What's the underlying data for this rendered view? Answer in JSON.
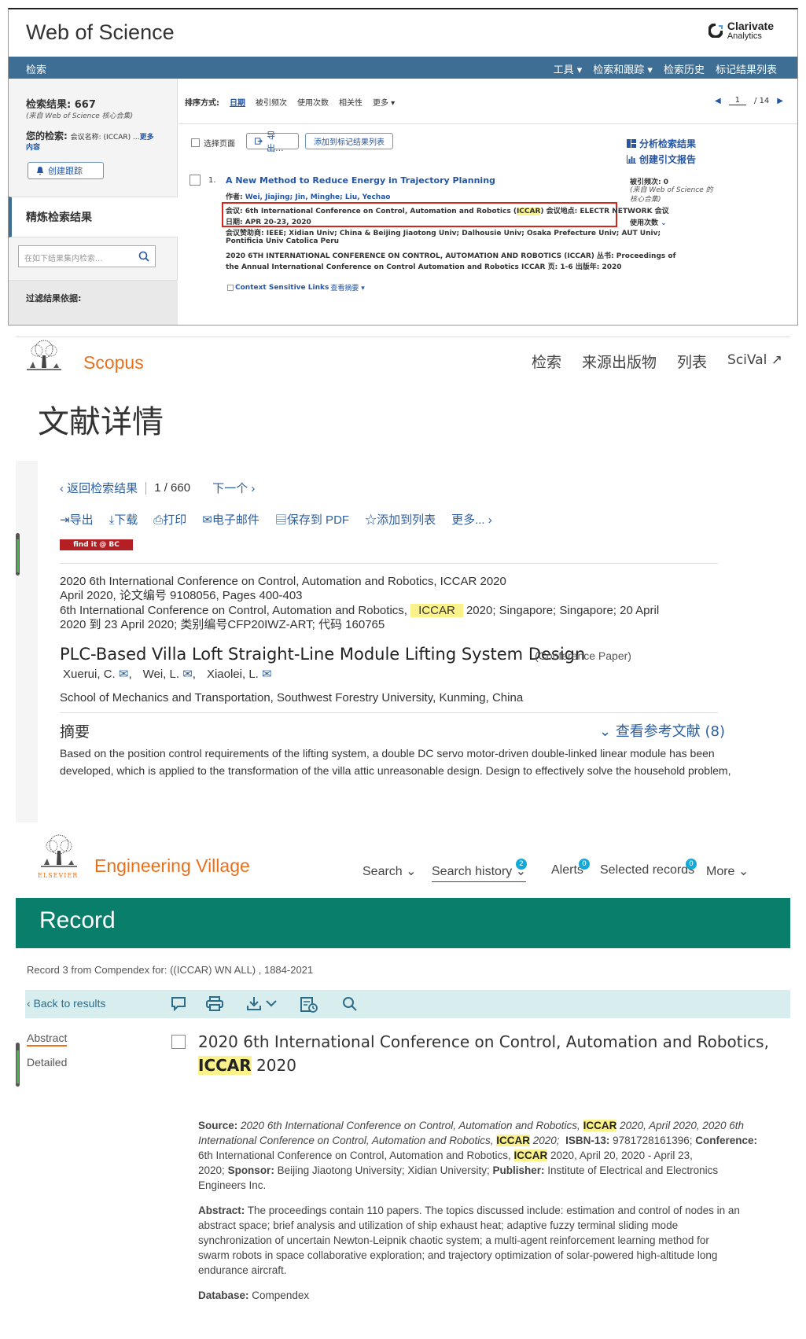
{
  "wos": {
    "logo": "Web of Science",
    "clarivate_line1": "Clarivate",
    "clarivate_line2": "Analytics",
    "nav_left": "检索",
    "nav_right": [
      "工具 ▾",
      "检索和跟踪 ▾",
      "检索历史",
      "标记结果列表"
    ],
    "results_label": "检索结果:",
    "results_count": "667",
    "results_source": "(来自 Web of Science 核心合集)",
    "your_search_label": "您的检索:",
    "your_search_value": "会议名称: (ICCAR) ...",
    "more_label": "更多",
    "content_label": "内容",
    "alert_button": "创建跟踪",
    "refine_label": "精炼检索结果",
    "refine_placeholder": "在如下结果集内检索...",
    "filter_label": "过滤结果依据:",
    "sort_label": "排序方式:",
    "sort_options": [
      "日期",
      "被引频次",
      "使用次数",
      "相关性",
      "更多 ▾"
    ],
    "page_current": "1",
    "page_total": "/ 14",
    "select_page": "选择页面",
    "export_button": "导出...",
    "add_marked": "添加到标记结果列表",
    "analyze": "分析检索结果",
    "citation_report": "创建引文报告",
    "record_num": "1.",
    "record_title": "A New Method to Reduce Energy in Trajectory Planning",
    "authors_label": "作者:",
    "authors": "Wei, Jiajing; Jin, Minghe; Liu, Yechao",
    "conf_pre": "会议: 6th International Conference on Control, Automation and Robotics (",
    "conf_hl": "ICCAR",
    "conf_post": ") 会议地点: ELECTR NETWORK 会议",
    "conf_date": "日期: APR 20-23, 2020",
    "sponsors_line1": "会议赞助商: IEEE; Xidian Univ; China & Beijing Jiaotong Univ; Dalhousie Univ; Osaka Prefecture Univ; AUT Univ;",
    "sponsors_line2": "Pontificia Univ Catolica Peru",
    "series_line1": "2020 6TH INTERNATIONAL CONFERENCE ON CONTROL, AUTOMATION AND ROBOTICS (ICCAR) 丛书: Proceedings of",
    "series_line2": "the Annual International Conference on Control Automation and Robotics ICCAR 页: 1-6 出版年: 2020",
    "context_links": "Context Sensitive Links",
    "view_abstract": "查看摘要 ▾",
    "times_cited": "被引频次: 0",
    "times_cited_source": "(来自 Web of Science 的核心合集)",
    "usage": "使用次数"
  },
  "scopus": {
    "brand": "Scopus",
    "nav": [
      "检索",
      "来源出版物",
      "列表",
      "SciVal ↗"
    ],
    "page_title": "文献详情",
    "back": "返回检索结果",
    "counter": "1 / 660",
    "next": "下一个",
    "actions": [
      "导出",
      "下载",
      "打印",
      "电子邮件",
      "保存到 PDF",
      "添加到列表",
      "更多..."
    ],
    "findit": "find it @ BC",
    "src_line1": "2020 6th International Conference on Control, Automation and Robotics, ICCAR 2020",
    "src_line2": "April 2020, 论文编号 9108056, Pages 400-403",
    "src_line3_pre": "6th International Conference on Control, Automation and Robotics,",
    "src_line3_hl": "ICCAR",
    "src_line3_post": "2020; Singapore; Singapore; 20 April",
    "src_line4": "2020 到 23 April 2020; 类别编号CFP20IWZ-ART; 代码 160765",
    "doc_title": "PLC-Based Villa Loft Straight-Line Module Lifting System Design",
    "doc_type": "(Conference Paper)",
    "authors": [
      "Xuerui, C.",
      "Wei, L.",
      "Xiaolei, L."
    ],
    "affiliation": "School of Mechanics and Transportation, Southwest Forestry University, Kunming, China",
    "abstract_label": "摘要",
    "refs_label": "查看参考文献 (8)",
    "abstract_line1": "Based on the position control requirements of the lifting system, a double DC servo motor-driven double-linked linear module has been",
    "abstract_line2": "developed, which is applied to the transformation of the villa attic unreasonable design. Design to effectively solve the household problem,"
  },
  "ev": {
    "brand": "Engineering Village",
    "elsevier": "ELSEVIER",
    "nav_search": "Search",
    "nav_history": "Search history",
    "nav_history_badge": "2",
    "nav_alerts": "Alerts",
    "nav_alerts_badge": "0",
    "nav_selected": "Selected records",
    "nav_selected_badge": "0",
    "nav_more": "More",
    "record_heading": "Record",
    "crumb": "Record 3 from Compendex for: ((ICCAR) WN ALL) , 1884-2021",
    "back": "Back to results",
    "tab_abstract": "Abstract",
    "tab_detailed": "Detailed",
    "title_line1": "2020 6th International Conference on Control, Automation and Robotics,",
    "title_hl": "ICCAR",
    "title_year": "2020",
    "source_label": "Source:",
    "s1a": "2020 6th International Conference on Control, Automation and Robotics,",
    "s1b": "2020, April 2020, 2020 6th",
    "s2a": "International Conference on Control, Automation and Robotics,",
    "s2b": "2020;",
    "isbn_label": "ISBN-13:",
    "isbn": "9781728161396;",
    "conf_label": "Conference:",
    "s3a": "6th International Conference on Control, Automation and Robotics,",
    "s3b": "2020, April 20, 2020 - April 23,",
    "s4a": "2020;",
    "sponsor_label": "Sponsor:",
    "sponsors": "Beijing Jiaotong University; Xidian University;",
    "publisher_label": "Publisher:",
    "publisher": "Institute of Electrical and Electronics",
    "s5": "Engineers Inc.",
    "abstract_label": "Abstract:",
    "ab1": "The proceedings contain 110 papers. The topics discussed include: estimation and control of nodes in an",
    "ab2": "abstract space; brief analysis and utilization of ship exhaust heat; adaptive fuzzy terminal sliding mode",
    "ab3": "synchronization of uncertain Newton-Leipnik chaotic system; a multi-agent reinforcement learning method for",
    "ab4": "swarm robots in space collaborative exploration; and trajectory optimization of solar-powered high-altitude long",
    "ab5": "endurance aircraft.",
    "db_label": "Database:",
    "db": "Compendex",
    "hl": "ICCAR"
  }
}
